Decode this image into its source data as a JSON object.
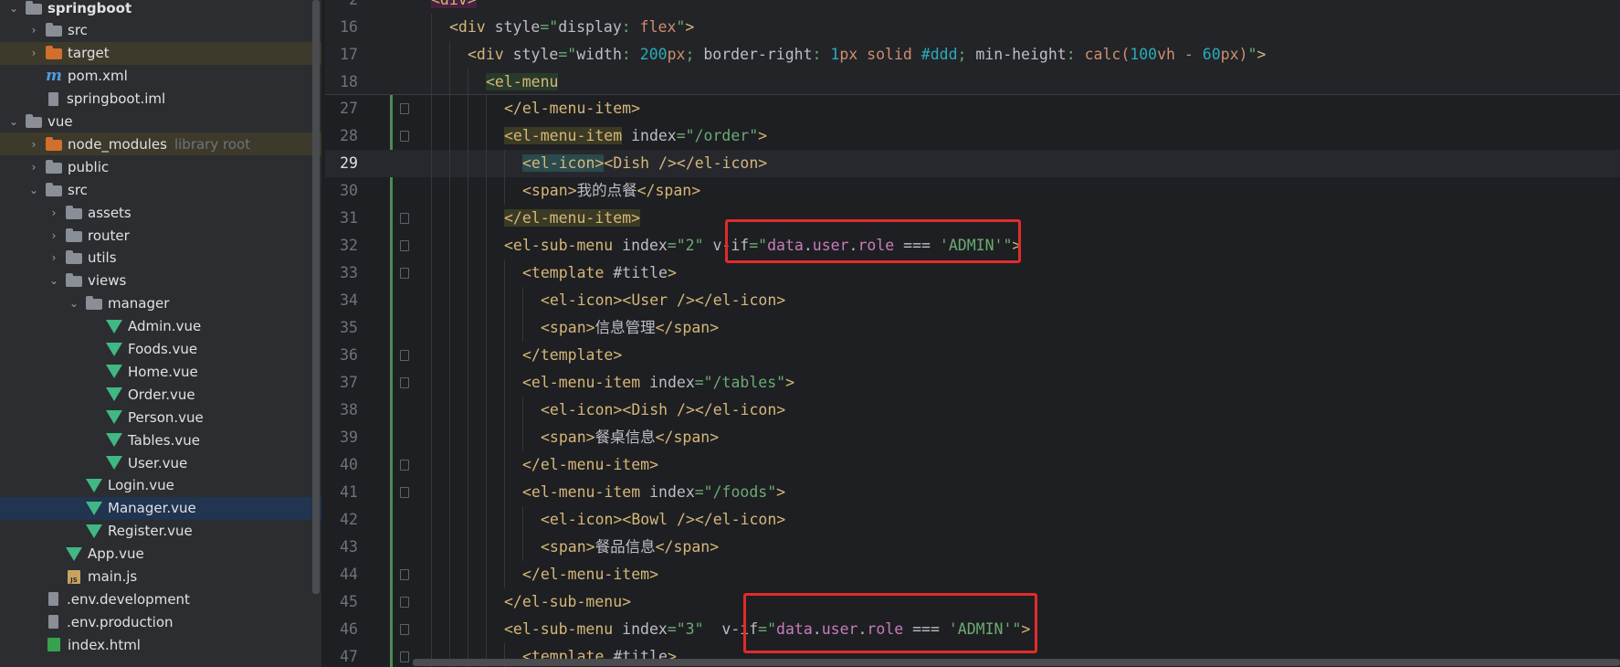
{
  "project_tree": {
    "items": [
      {
        "label": "springboot",
        "hint": "",
        "depth": 1,
        "expanded": true,
        "type": "module",
        "selected": ""
      },
      {
        "label": "src",
        "hint": "",
        "depth": 2,
        "expanded": false,
        "type": "folder",
        "selected": ""
      },
      {
        "label": "target",
        "hint": "",
        "depth": 2,
        "expanded": false,
        "type": "folder-orange",
        "selected": "dir"
      },
      {
        "label": "pom.xml",
        "hint": "",
        "depth": 2,
        "expanded": null,
        "type": "maven",
        "selected": ""
      },
      {
        "label": "springboot.iml",
        "hint": "",
        "depth": 2,
        "expanded": null,
        "type": "file",
        "selected": ""
      },
      {
        "label": "vue",
        "hint": "",
        "depth": 1,
        "expanded": true,
        "type": "folder",
        "selected": ""
      },
      {
        "label": "node_modules",
        "hint": "library root",
        "depth": 2,
        "expanded": false,
        "type": "folder-orange",
        "selected": "dir"
      },
      {
        "label": "public",
        "hint": "",
        "depth": 2,
        "expanded": false,
        "type": "folder",
        "selected": ""
      },
      {
        "label": "src",
        "hint": "",
        "depth": 2,
        "expanded": true,
        "type": "folder",
        "selected": ""
      },
      {
        "label": "assets",
        "hint": "",
        "depth": 3,
        "expanded": false,
        "type": "folder",
        "selected": ""
      },
      {
        "label": "router",
        "hint": "",
        "depth": 3,
        "expanded": false,
        "type": "folder",
        "selected": ""
      },
      {
        "label": "utils",
        "hint": "",
        "depth": 3,
        "expanded": false,
        "type": "folder",
        "selected": ""
      },
      {
        "label": "views",
        "hint": "",
        "depth": 3,
        "expanded": true,
        "type": "folder",
        "selected": ""
      },
      {
        "label": "manager",
        "hint": "",
        "depth": 4,
        "expanded": true,
        "type": "folder",
        "selected": ""
      },
      {
        "label": "Admin.vue",
        "hint": "",
        "depth": 5,
        "expanded": null,
        "type": "vue",
        "selected": ""
      },
      {
        "label": "Foods.vue",
        "hint": "",
        "depth": 5,
        "expanded": null,
        "type": "vue",
        "selected": ""
      },
      {
        "label": "Home.vue",
        "hint": "",
        "depth": 5,
        "expanded": null,
        "type": "vue",
        "selected": ""
      },
      {
        "label": "Order.vue",
        "hint": "",
        "depth": 5,
        "expanded": null,
        "type": "vue",
        "selected": ""
      },
      {
        "label": "Person.vue",
        "hint": "",
        "depth": 5,
        "expanded": null,
        "type": "vue",
        "selected": ""
      },
      {
        "label": "Tables.vue",
        "hint": "",
        "depth": 5,
        "expanded": null,
        "type": "vue",
        "selected": ""
      },
      {
        "label": "User.vue",
        "hint": "",
        "depth": 5,
        "expanded": null,
        "type": "vue",
        "selected": ""
      },
      {
        "label": "Login.vue",
        "hint": "",
        "depth": 4,
        "expanded": null,
        "type": "vue",
        "selected": ""
      },
      {
        "label": "Manager.vue",
        "hint": "",
        "depth": 4,
        "expanded": null,
        "type": "vue",
        "selected": "file"
      },
      {
        "label": "Register.vue",
        "hint": "",
        "depth": 4,
        "expanded": null,
        "type": "vue",
        "selected": ""
      },
      {
        "label": "App.vue",
        "hint": "",
        "depth": 3,
        "expanded": null,
        "type": "vue",
        "selected": ""
      },
      {
        "label": "main.js",
        "hint": "",
        "depth": 3,
        "expanded": null,
        "type": "js",
        "selected": ""
      },
      {
        "label": ".env.development",
        "hint": "",
        "depth": 2,
        "expanded": null,
        "type": "file",
        "selected": ""
      },
      {
        "label": ".env.production",
        "hint": "",
        "depth": 2,
        "expanded": null,
        "type": "file",
        "selected": ""
      },
      {
        "label": "index.html",
        "hint": "",
        "depth": 2,
        "expanded": null,
        "type": "html",
        "selected": ""
      }
    ]
  },
  "editor": {
    "sticky_lines": [
      {
        "num": "2",
        "indent": 0,
        "tokens": [
          [
            "tag-hl2",
            "<div>"
          ]
        ]
      },
      {
        "num": "16",
        "indent": 1,
        "tokens": [
          [
            "tag",
            "<div "
          ],
          [
            "attr",
            "style"
          ],
          [
            "str",
            "=\""
          ],
          [
            "attr",
            "display"
          ],
          [
            "str",
            ": "
          ],
          [
            "kw",
            "flex"
          ],
          [
            "str",
            "\""
          ],
          [
            "tag",
            ">"
          ]
        ]
      },
      {
        "num": "17",
        "indent": 2,
        "tokens": [
          [
            "tag",
            "<div "
          ],
          [
            "attr",
            "style"
          ],
          [
            "str",
            "=\""
          ],
          [
            "attr",
            "width"
          ],
          [
            "str",
            ": "
          ],
          [
            "num",
            "200"
          ],
          [
            "kw",
            "px"
          ],
          [
            "str",
            "; "
          ],
          [
            "attr",
            "border-right"
          ],
          [
            "str",
            ": "
          ],
          [
            "num",
            "1"
          ],
          [
            "kw",
            "px solid "
          ],
          [
            "num",
            "#ddd"
          ],
          [
            "str",
            "; "
          ],
          [
            "attr",
            "min-height"
          ],
          [
            "str",
            ": "
          ],
          [
            "kw",
            "calc("
          ],
          [
            "num",
            "100"
          ],
          [
            "kw",
            "vh - "
          ],
          [
            "num",
            "60"
          ],
          [
            "kw",
            "px)"
          ],
          [
            "str",
            "\""
          ],
          [
            "tag",
            ">"
          ]
        ]
      },
      {
        "num": "18",
        "indent": 3,
        "tokens": [
          [
            "tag-hl",
            "<el-menu"
          ]
        ]
      }
    ],
    "lines": [
      {
        "num": "27",
        "indent": 4,
        "fold": true,
        "tokens": [
          [
            "tag",
            "</el-menu-item>"
          ]
        ]
      },
      {
        "num": "28",
        "indent": 4,
        "fold": true,
        "tokens": [
          [
            "tag-hl-y",
            "<el-menu-item"
          ],
          [
            "attr",
            " index"
          ],
          [
            "str",
            "=\"/order\""
          ],
          [
            "tag",
            ">"
          ]
        ]
      },
      {
        "num": "29",
        "indent": 5,
        "fold": false,
        "current": true,
        "tokens": [
          [
            "tag-hl-b",
            "<el-icon>"
          ],
          [
            "tag",
            "<Dish />"
          ],
          [
            "tag",
            "</el-icon>"
          ]
        ]
      },
      {
        "num": "30",
        "indent": 5,
        "fold": false,
        "tokens": [
          [
            "tag",
            "<span>"
          ],
          [
            "attr",
            "我的点餐"
          ],
          [
            "tag",
            "</span>"
          ]
        ]
      },
      {
        "num": "31",
        "indent": 4,
        "fold": true,
        "tokens": [
          [
            "tag-hl-y",
            "</el-menu-item>"
          ]
        ]
      },
      {
        "num": "32",
        "indent": 4,
        "fold": true,
        "tokens": [
          [
            "tag",
            "<el-sub-menu "
          ],
          [
            "attr",
            "index"
          ],
          [
            "str",
            "=\"2\" "
          ],
          [
            "attr",
            "v-if"
          ],
          [
            "str",
            "=\""
          ],
          [
            "prop",
            "data"
          ],
          [
            "attr",
            "."
          ],
          [
            "prop",
            "user"
          ],
          [
            "attr",
            "."
          ],
          [
            "prop",
            "role"
          ],
          [
            "attr",
            " === "
          ],
          [
            "str",
            "'ADMIN'\""
          ],
          [
            "tag",
            ">"
          ]
        ]
      },
      {
        "num": "33",
        "indent": 5,
        "fold": true,
        "tokens": [
          [
            "tag",
            "<template "
          ],
          [
            "attr",
            "#title"
          ],
          [
            "tag",
            ">"
          ]
        ]
      },
      {
        "num": "34",
        "indent": 6,
        "fold": false,
        "tokens": [
          [
            "tag",
            "<el-icon><User /></el-icon>"
          ]
        ]
      },
      {
        "num": "35",
        "indent": 6,
        "fold": false,
        "tokens": [
          [
            "tag",
            "<span>"
          ],
          [
            "attr",
            "信息管理"
          ],
          [
            "tag",
            "</span>"
          ]
        ]
      },
      {
        "num": "36",
        "indent": 5,
        "fold": true,
        "tokens": [
          [
            "tag",
            "</template>"
          ]
        ]
      },
      {
        "num": "37",
        "indent": 5,
        "fold": true,
        "tokens": [
          [
            "tag",
            "<el-menu-item "
          ],
          [
            "attr",
            "index"
          ],
          [
            "str",
            "=\"/tables\""
          ],
          [
            "tag",
            ">"
          ]
        ]
      },
      {
        "num": "38",
        "indent": 6,
        "fold": false,
        "tokens": [
          [
            "tag",
            "<el-icon><Dish /></el-icon>"
          ]
        ]
      },
      {
        "num": "39",
        "indent": 6,
        "fold": false,
        "tokens": [
          [
            "tag",
            "<span>"
          ],
          [
            "attr",
            "餐桌信息"
          ],
          [
            "tag",
            "</span>"
          ]
        ]
      },
      {
        "num": "40",
        "indent": 5,
        "fold": true,
        "tokens": [
          [
            "tag",
            "</el-menu-item>"
          ]
        ]
      },
      {
        "num": "41",
        "indent": 5,
        "fold": true,
        "tokens": [
          [
            "tag",
            "<el-menu-item "
          ],
          [
            "attr",
            "index"
          ],
          [
            "str",
            "=\"/foods\""
          ],
          [
            "tag",
            ">"
          ]
        ]
      },
      {
        "num": "42",
        "indent": 6,
        "fold": false,
        "tokens": [
          [
            "tag",
            "<el-icon><Bowl /></el-icon>"
          ]
        ]
      },
      {
        "num": "43",
        "indent": 6,
        "fold": false,
        "tokens": [
          [
            "tag",
            "<span>"
          ],
          [
            "attr",
            "餐品信息"
          ],
          [
            "tag",
            "</span>"
          ]
        ]
      },
      {
        "num": "44",
        "indent": 5,
        "fold": true,
        "tokens": [
          [
            "tag",
            "</el-menu-item>"
          ]
        ]
      },
      {
        "num": "45",
        "indent": 4,
        "fold": true,
        "tokens": [
          [
            "tag",
            "</el-sub-menu>"
          ]
        ]
      },
      {
        "num": "46",
        "indent": 4,
        "fold": true,
        "tokens": [
          [
            "tag",
            "<el-sub-menu "
          ],
          [
            "attr",
            "index"
          ],
          [
            "str",
            "=\"3\"  "
          ],
          [
            "attr",
            "v-if"
          ],
          [
            "str",
            "=\""
          ],
          [
            "prop",
            "data"
          ],
          [
            "attr",
            "."
          ],
          [
            "prop",
            "user"
          ],
          [
            "attr",
            "."
          ],
          [
            "prop",
            "role"
          ],
          [
            "attr",
            " === "
          ],
          [
            "str",
            "'ADMIN'\""
          ],
          [
            "tag",
            ">"
          ]
        ]
      },
      {
        "num": "47",
        "indent": 5,
        "fold": true,
        "tokens": [
          [
            "tag",
            "<template "
          ],
          [
            "attr",
            "#title"
          ],
          [
            "tag",
            ">"
          ]
        ]
      }
    ]
  },
  "colors": {
    "annotation_box": "#e12b2b",
    "vcs_modified_bar": "#4d8c55"
  }
}
